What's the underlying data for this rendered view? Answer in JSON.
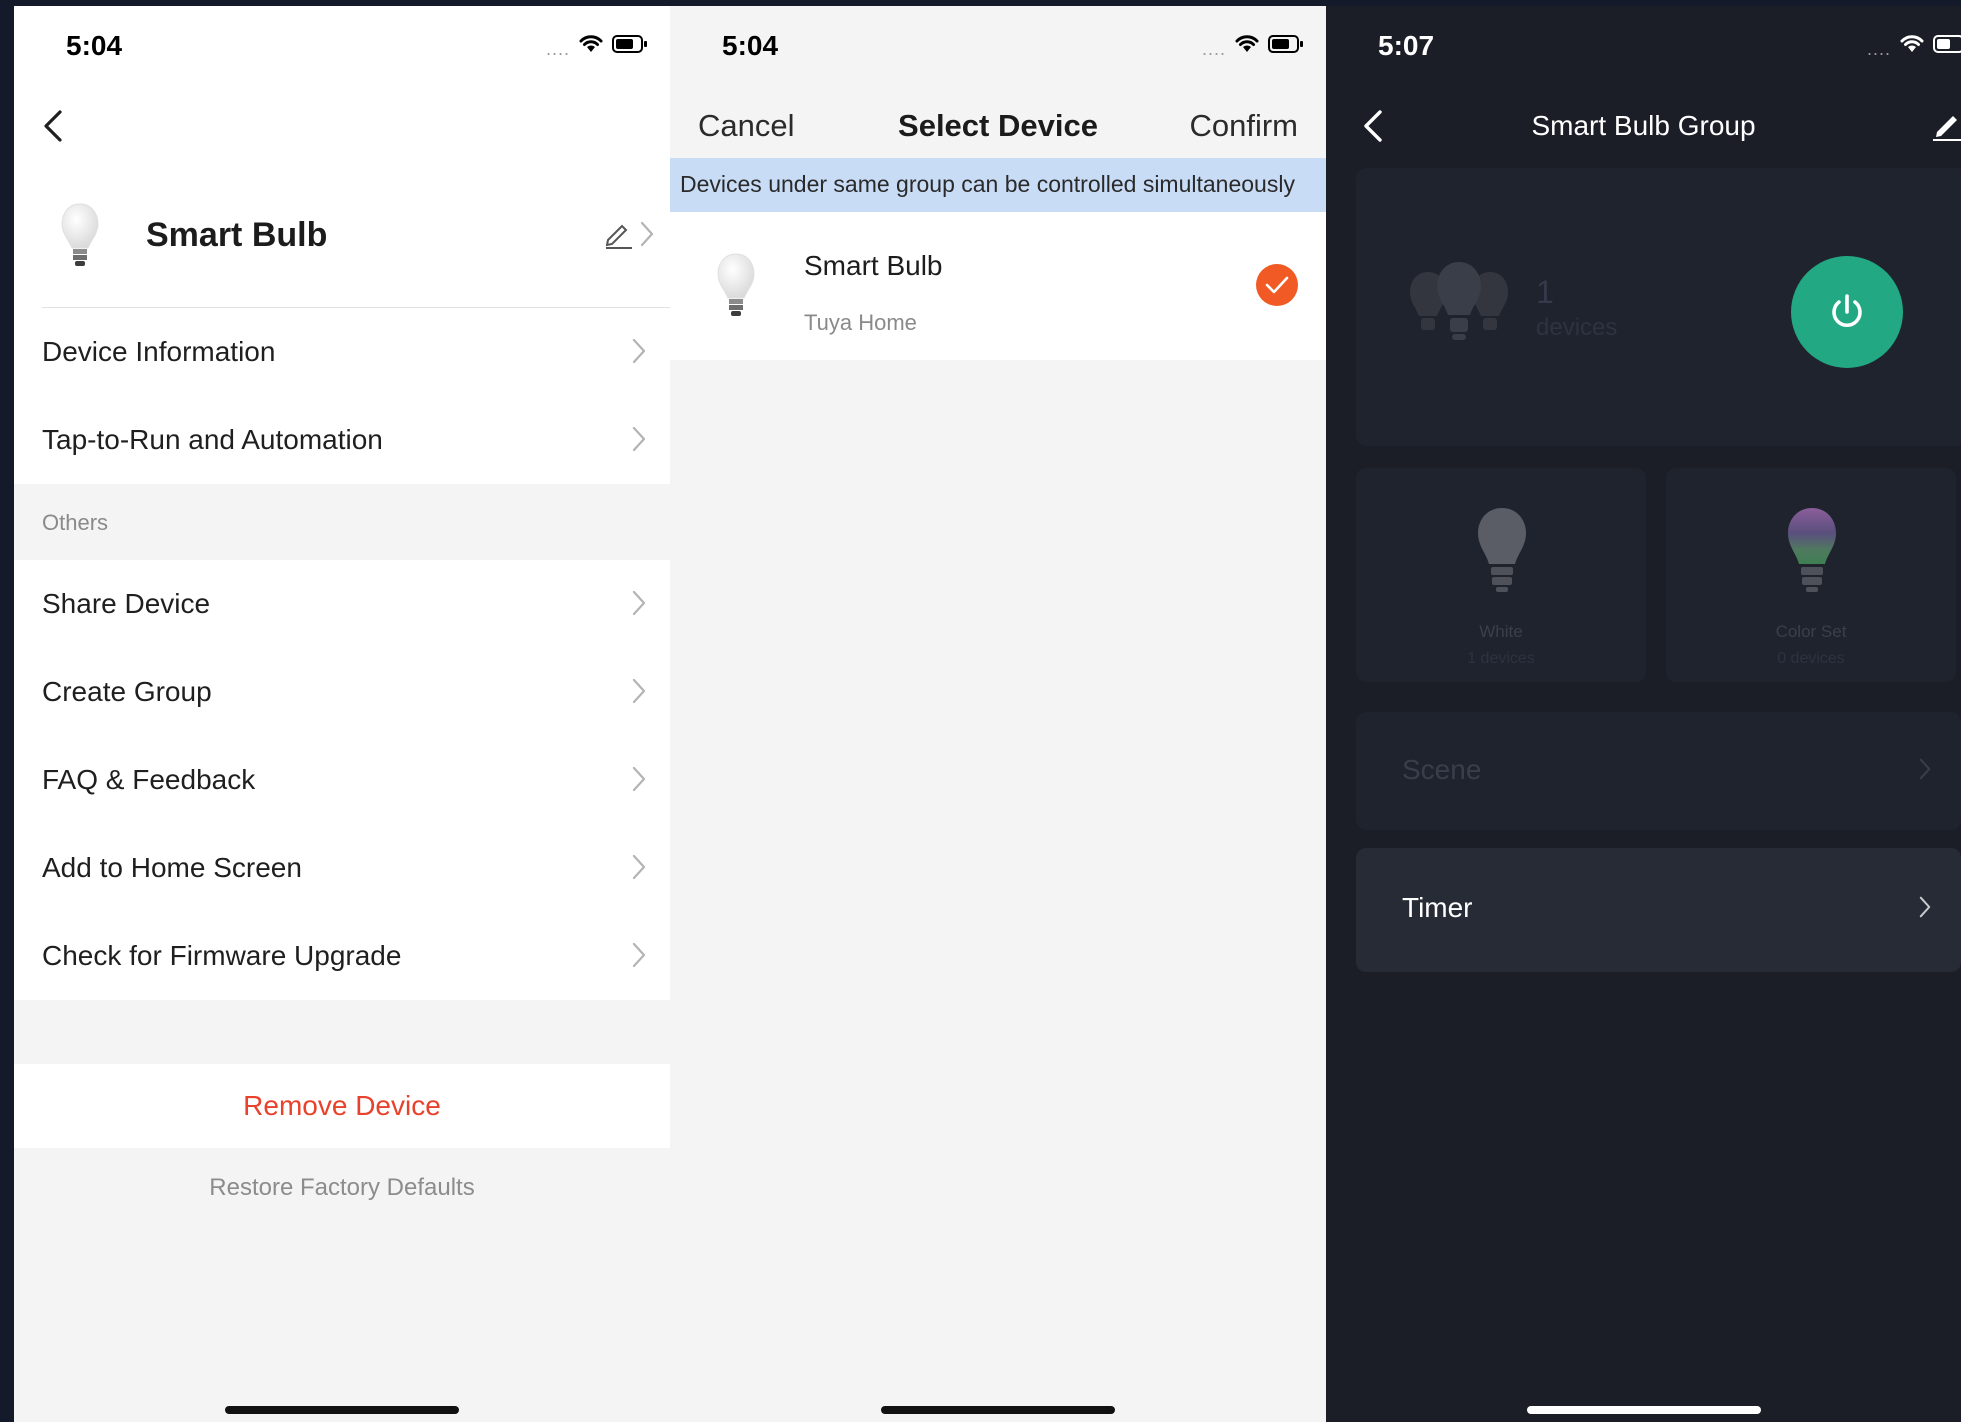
{
  "colors": {
    "accent_red": "#e8412c",
    "check_orange": "#f15a24",
    "banner_blue": "#c9dcf6",
    "power_green": "#22a882",
    "dark_bg": "#1b1e27"
  },
  "settings_screen": {
    "status": {
      "time": "5:04"
    },
    "back_icon": "chevron-left-icon",
    "device": {
      "name": "Smart Bulb",
      "icon": "bulb-icon",
      "edit_icon": "pencil-icon"
    },
    "items_top": [
      {
        "label": "Device Information"
      },
      {
        "label": "Tap-to-Run and Automation"
      }
    ],
    "others_header": "Others",
    "items_others": [
      {
        "label": "Share Device"
      },
      {
        "label": "Create Group"
      },
      {
        "label": "FAQ & Feedback"
      },
      {
        "label": "Add to Home Screen"
      },
      {
        "label": "Check for Firmware Upgrade"
      }
    ],
    "remove_label": "Remove Device",
    "restore_label": "Restore Factory Defaults"
  },
  "select_screen": {
    "status": {
      "time": "5:04"
    },
    "cancel_label": "Cancel",
    "title": "Select Device",
    "confirm_label": "Confirm",
    "banner": "Devices under same group can be controlled simultaneously",
    "device": {
      "name": "Smart Bulb",
      "room": "Tuya Home",
      "selected": true
    }
  },
  "group_screen": {
    "status": {
      "time": "5:07"
    },
    "title": "Smart Bulb Group",
    "device_count": "1",
    "device_unit": "devices",
    "modes": [
      {
        "label": "White",
        "sub": "1 devices"
      },
      {
        "label": "Color Set",
        "sub": "0 devices"
      }
    ],
    "scene_label": "Scene",
    "timer_label": "Timer"
  }
}
